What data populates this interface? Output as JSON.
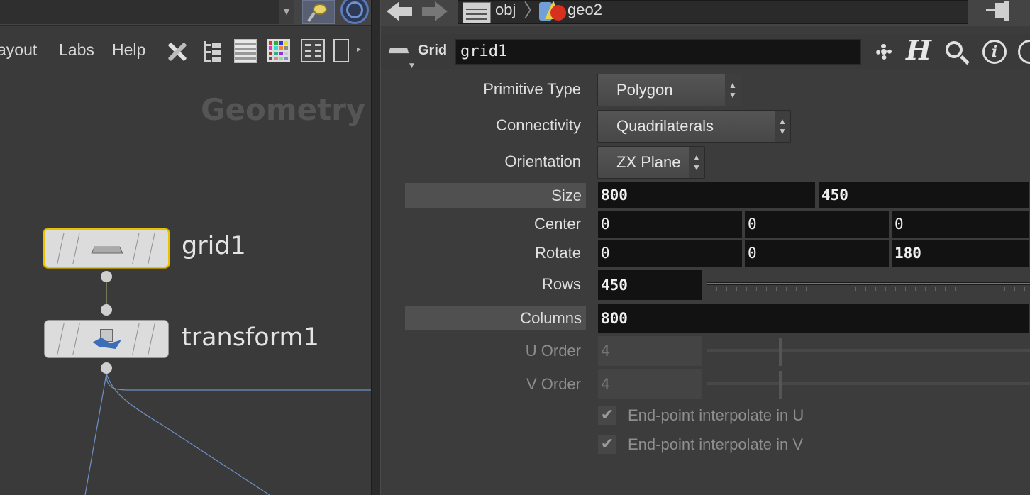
{
  "left": {
    "menu": {
      "layout": "ayout",
      "labs": "Labs",
      "help": "Help"
    },
    "network_title": "Geometry",
    "nodes": [
      {
        "name": "grid1",
        "selected": true,
        "icon": "grid-node-icon"
      },
      {
        "name": "transform1",
        "selected": false,
        "icon": "transform-node-icon"
      }
    ]
  },
  "right": {
    "path": {
      "root": "obj",
      "node": "geo2"
    },
    "operator_type": "Grid",
    "node_name": "grid1",
    "params": {
      "primitive_type": {
        "label": "Primitive Type",
        "value": "Polygon"
      },
      "connectivity": {
        "label": "Connectivity",
        "value": "Quadrilaterals"
      },
      "orientation": {
        "label": "Orientation",
        "value": "ZX Plane"
      },
      "size": {
        "label": "Size",
        "values": [
          "800",
          "450"
        ]
      },
      "center": {
        "label": "Center",
        "values": [
          "0",
          "0",
          "0"
        ]
      },
      "rotate": {
        "label": "Rotate",
        "values": [
          "0",
          "0",
          "180"
        ]
      },
      "rows": {
        "label": "Rows",
        "value": "450"
      },
      "columns": {
        "label": "Columns",
        "value": "800"
      },
      "u_order": {
        "label": "U Order",
        "value": "4"
      },
      "v_order": {
        "label": "V Order",
        "value": "4"
      },
      "interp_u": {
        "label": "End-point interpolate in U",
        "checked": true
      },
      "interp_v": {
        "label": "End-point interpolate in V",
        "checked": true
      }
    }
  },
  "colors": {
    "selection": "#e8c200",
    "wire": "#6f8fc4",
    "accent": "#4f7ac8"
  }
}
